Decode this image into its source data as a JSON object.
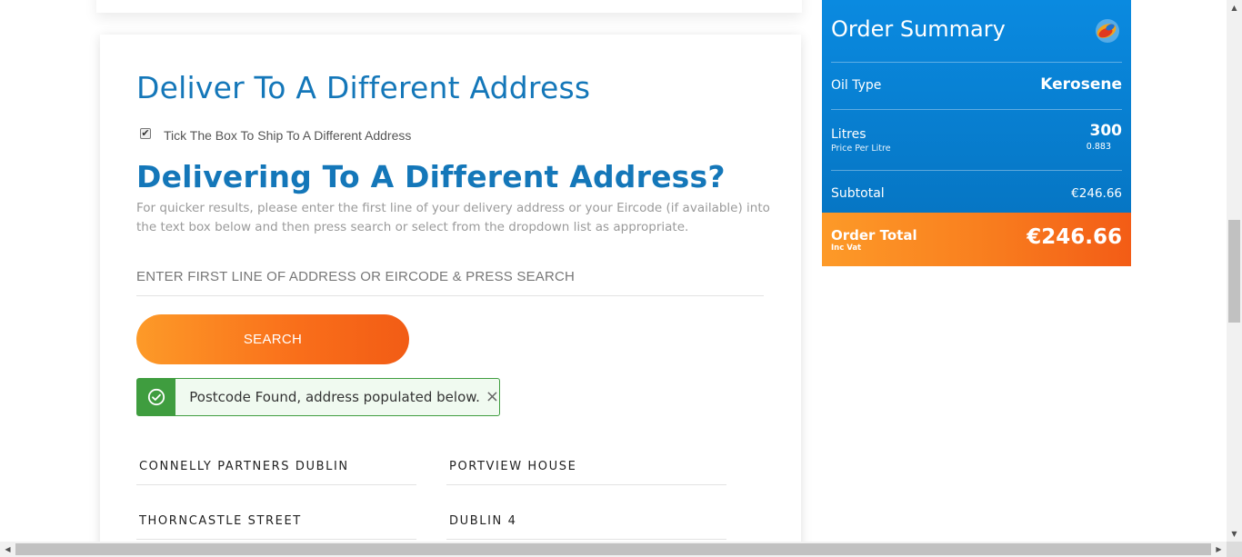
{
  "form": {
    "heading": "Deliver To A Different Address",
    "checkbox_label": "Tick The Box To Ship To A Different Address",
    "checkbox_checked": true,
    "subheading": "Delivering To A Different Address?",
    "help_text": "For quicker results, please enter the first line of your delivery address or your Eircode (if available) into the text box below and then press search or select from the dropdown list as appropriate.",
    "address_placeholder": "ENTER FIRST LINE OF ADDRESS OR EIRCODE & PRESS SEARCH",
    "search_label": "SEARCH",
    "alert_text": "Postcode Found, address populated below.",
    "alert_close": "×",
    "fields": {
      "line1": "CONNELLY PARTNERS DUBLIN",
      "line2": "PORTVIEW HOUSE",
      "line3": "THORNCASTLE STREET",
      "line4": "DUBLIN 4"
    }
  },
  "summary": {
    "title": "Order Summary",
    "oil_type_label": "Oil Type",
    "oil_type_value": "Kerosene",
    "litres_label": "Litres",
    "litres_value": "300",
    "price_per_litre_label": "Price Per Litre",
    "price_per_litre_value": "0.883",
    "subtotal_label": "Subtotal",
    "subtotal_value": "€246.66",
    "total_label": "Order Total",
    "total_sub_label": "Inc Vat",
    "total_value": "€246.66"
  },
  "colors": {
    "heading_blue": "#1477b9",
    "summary_blue": "#0a8ae0",
    "accent_orange": "#f96e1a",
    "success_green": "#3f9d3f"
  }
}
